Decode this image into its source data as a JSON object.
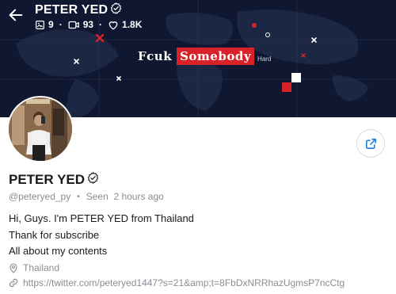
{
  "header": {
    "name": "PETER YED",
    "stats": {
      "photos": "9",
      "videos": "93",
      "likes": "1.8K"
    }
  },
  "banner": {
    "text_1": "Fcuk",
    "text_2": "Somebody",
    "text_3": "Hard"
  },
  "profile": {
    "name": "PETER YED",
    "handle": "@peteryed_py",
    "last_seen": "Seen  2 hours ago",
    "bio": [
      "Hi, Guys. I'm PETER YED from Thailand",
      "Thank for subscribe",
      "All about my contents"
    ],
    "location": "Thailand",
    "link": "https://twitter.com/peteryed1447?s=21&amp;t=8FbDxNRRhazUgmsP7ncCtg"
  },
  "colors": {
    "banner_bg": "#0f1830",
    "accent_red": "#d9212a",
    "share_icon": "#1a7fd6",
    "muted_text": "#8a8d93"
  },
  "icons": {
    "back": "arrow-left-icon",
    "verified": "verified-badge-icon",
    "photos": "image-icon",
    "videos": "video-icon",
    "likes": "heart-icon",
    "share": "share-icon",
    "location": "map-pin-icon",
    "link": "link-icon"
  }
}
